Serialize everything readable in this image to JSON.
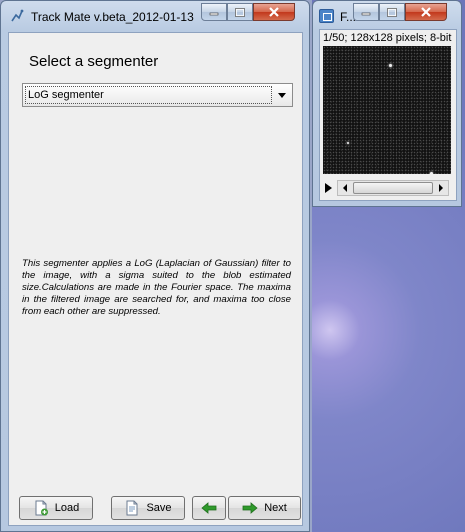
{
  "main_window": {
    "title": "Track Mate v.beta_2012-01-13",
    "heading": "Select a segmenter",
    "segmenter_select": {
      "selected": "LoG segmenter"
    },
    "description": "This segmenter applies a LoG (Laplacian of Gaussian) filter to the image, with a sigma suited to the blob estimated size.Calculations are made in the Fourier space. The maxima in the filtered image are searched for, and maxima too close from each other are suppressed.",
    "buttons": {
      "load": "Load",
      "save": "Save",
      "next": "Next"
    }
  },
  "image_window": {
    "title": "F...",
    "info": "1/50; 128x128 pixels; 8-bit"
  },
  "colors": {
    "titlebar": "#b9cbe2",
    "close_button": "#c2381c",
    "panel": "#efefef",
    "image_background": "#121212",
    "arrow_green": "#2f9a2b"
  }
}
